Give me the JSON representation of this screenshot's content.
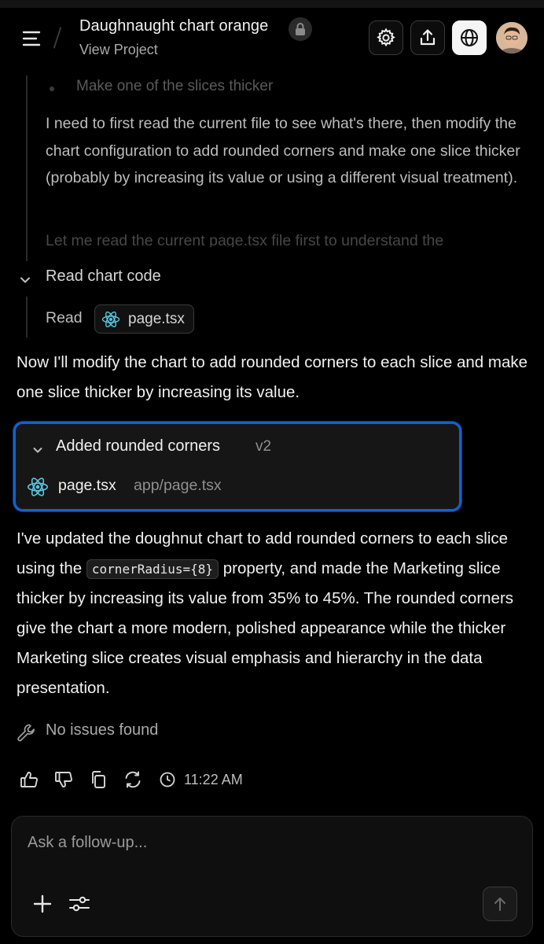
{
  "header": {
    "project_title": "Daughnaught chart orange",
    "view_project_label": "View Project"
  },
  "thread": {
    "faded_bullet": "Make one of the slices thicker",
    "reasoning_text": "I need to first read the current file to see what's there, then modify the chart configuration to add rounded corners and make one slice thicker (probably by increasing its value or using a different visual treatment).",
    "reasoning_faded": "Let me read the current page.tsx file first to understand the",
    "step_title": "Read chart code",
    "read_label": "Read",
    "read_file": "page.tsx"
  },
  "message": {
    "intro": "Now I'll modify the chart to add rounded corners to each slice and make one slice thicker by increasing its value.",
    "card": {
      "title": "Added rounded corners",
      "version": "v2",
      "file_name": "page.tsx",
      "file_path": "app/page.tsx"
    },
    "body_before_code": "I've updated the doughnut chart to add rounded corners to each slice using the",
    "code": "cornerRadius={8}",
    "body_after_code": "property, and made the Marketing slice thicker by increasing its value from 35% to 45%. The rounded corners give the chart a more modern, polished appearance while the thicker Marketing slice creates visual emphasis and hierarchy in the data presentation.",
    "issues": "No issues found",
    "time": "11:22 AM"
  },
  "composer": {
    "placeholder": "Ask a follow-up..."
  },
  "colors": {
    "accent_border": "#1661c8",
    "react_icon": "#58c4dc"
  }
}
